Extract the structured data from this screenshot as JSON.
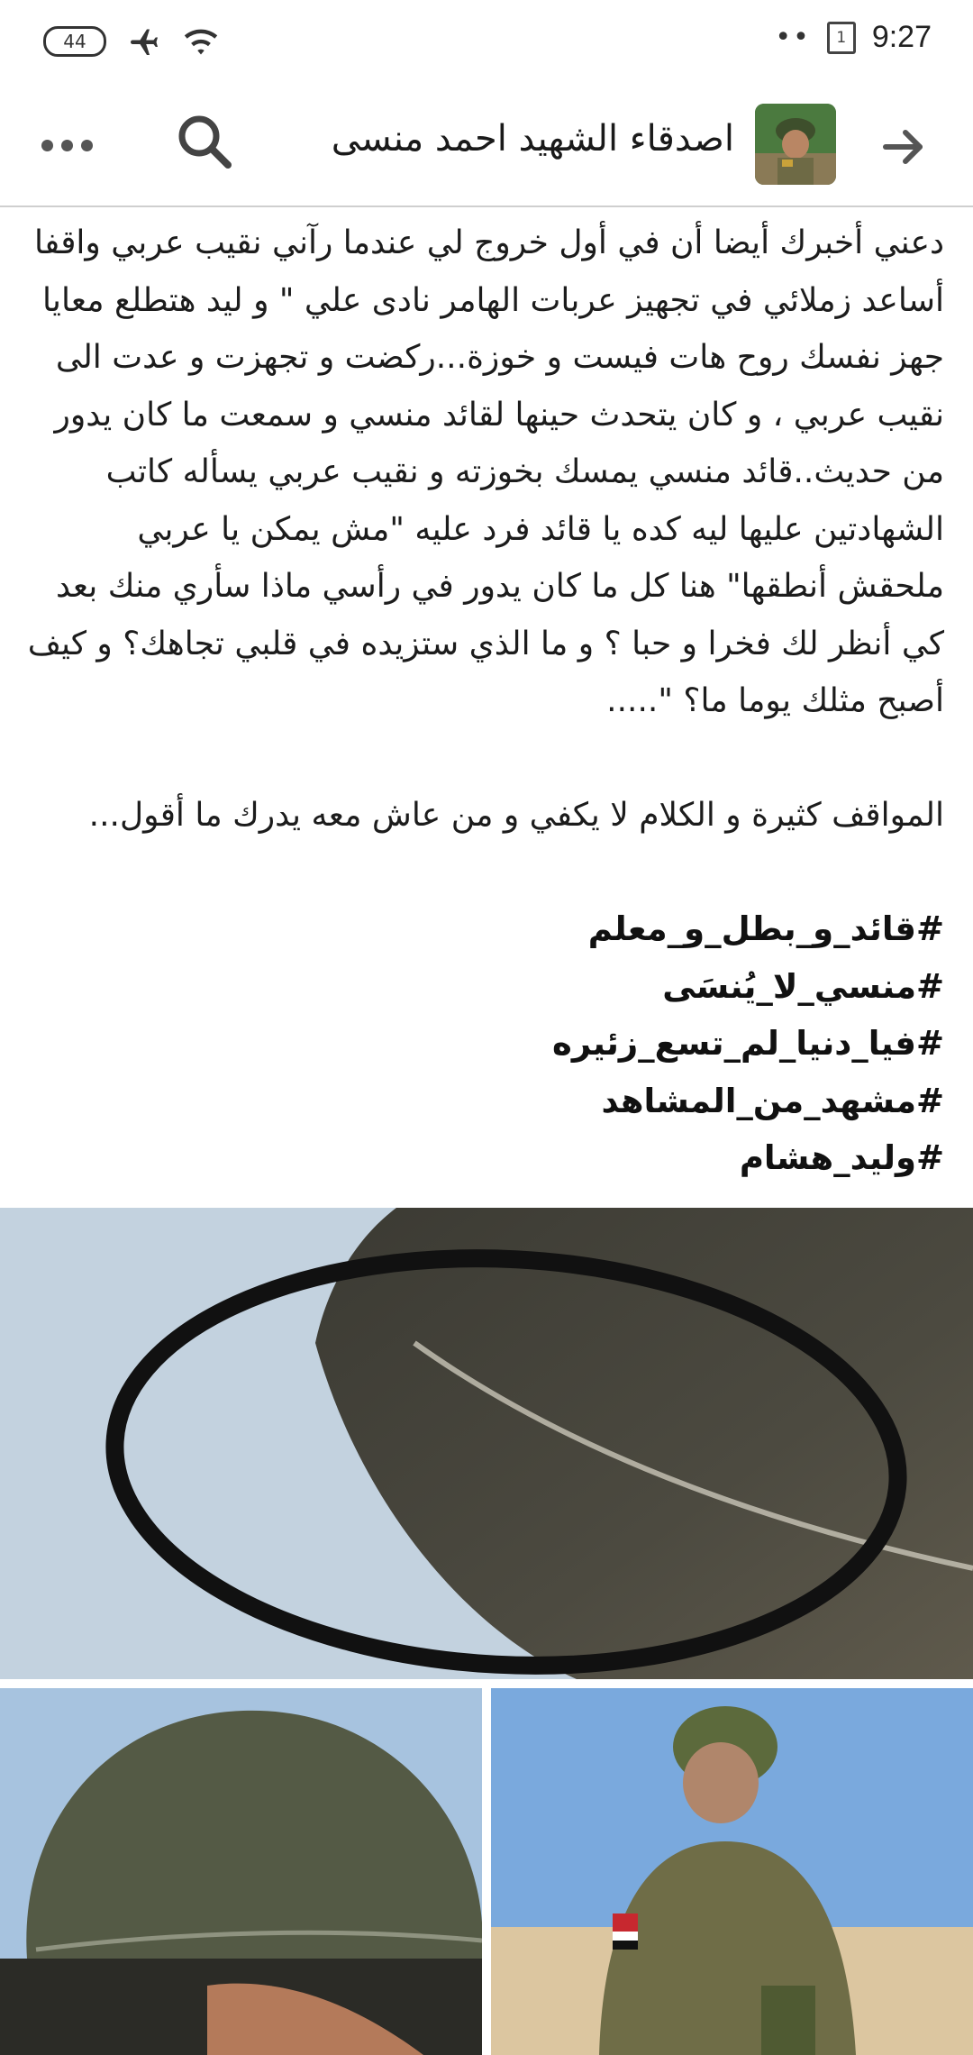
{
  "status_bar": {
    "battery": "44",
    "time": "9:27",
    "sim_label": "1",
    "dots": "••"
  },
  "header": {
    "title": "اصدقاء الشهيد احمد منسى"
  },
  "post": {
    "paragraphs": [
      "دعني أخبرك أيضا أن في أول خروج لي عندما رآني نقيب عربي واقفا أساعد زملائي في تجهيز عربات الهامر نادى علي \" و ليد هتطلع معايا جهز نفسك روح هات فيست و خوزة...ركضت و تجهزت و عدت الى نقيب عربي ، و كان يتحدث حينها لقائد منسي و سمعت ما كان يدور من حديث..قائد منسي يمسك بخوزته و نقيب عربي يسأله كاتب الشهادتين عليها ليه كده يا قائد فرد عليه \"مش يمكن يا عربي ملحقش أنطقها\" هنا كل ما كان يدور في رأسي ماذا سأري منك بعد كي أنظر لك فخرا و حبا ؟ و ما الذي ستزيده في قلبي تجاهك؟ و كيف أصبح مثلك يوما ما؟ \".....",
      "المواقف كثيرة و الكلام لا يكفي و من عاش معه يدرك ما أقول..."
    ],
    "hashtags": [
      "#قائد_و_بطل_و_معلم",
      "#منسي_لا_يُنسَى",
      "#فيا_دنيا_لم_تسع_زئيره",
      "#مشهد_من_المشاهد",
      "#وليد_هشام"
    ]
  },
  "icons": {
    "more": "more-horizontal-icon",
    "search": "search-icon",
    "back": "arrow-right-icon",
    "airplane": "airplane-icon",
    "wifi": "wifi-icon"
  }
}
